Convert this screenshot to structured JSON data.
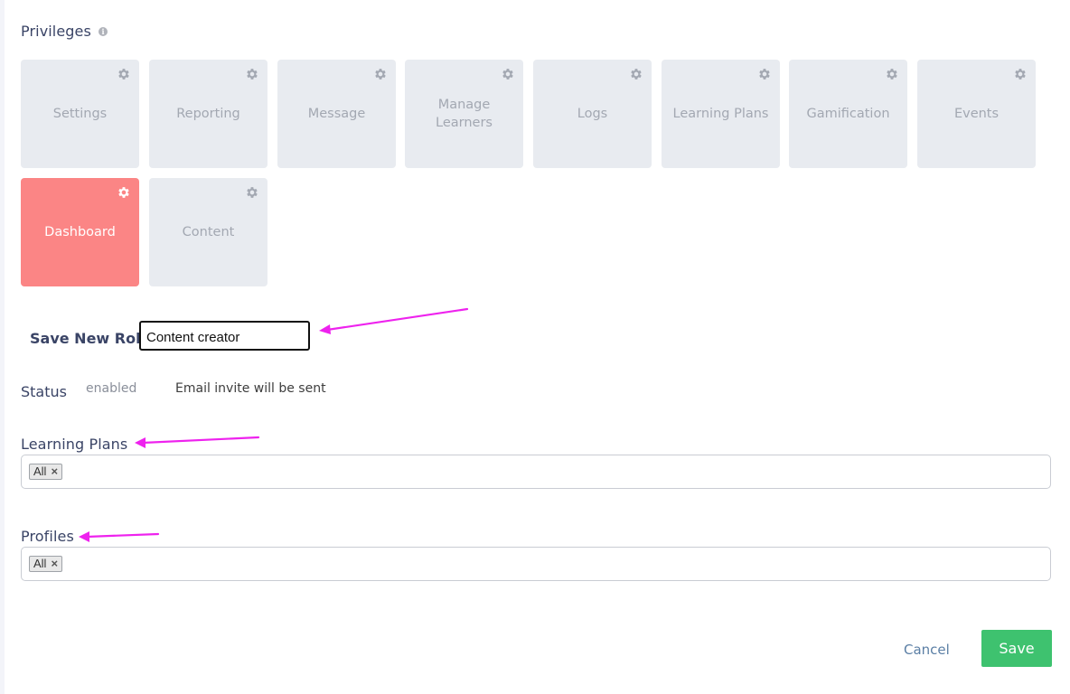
{
  "privileges": {
    "title": "Privileges",
    "info_icon": "info-icon",
    "tiles": [
      {
        "label": "Settings",
        "active": false
      },
      {
        "label": "Reporting",
        "active": false
      },
      {
        "label": "Message",
        "active": false
      },
      {
        "label": "Manage Learners",
        "active": false
      },
      {
        "label": "Logs",
        "active": false
      },
      {
        "label": "Learning Plans",
        "active": false
      },
      {
        "label": "Gamification",
        "active": false
      },
      {
        "label": "Events",
        "active": false
      },
      {
        "label": "Dashboard",
        "active": true
      },
      {
        "label": "Content",
        "active": false
      }
    ],
    "tile_icon": "gear-icon",
    "active_color": "#fb8585",
    "inactive_color": "#e8ebf0"
  },
  "role": {
    "label": "Save New Role",
    "value": "Content creator"
  },
  "status": {
    "label": "Status",
    "value": "enabled",
    "note": "Email invite will be sent"
  },
  "learning_plans": {
    "label": "Learning Plans",
    "chips": [
      {
        "label": "All",
        "remove": "×"
      }
    ]
  },
  "profiles": {
    "label": "Profiles",
    "chips": [
      {
        "label": "All",
        "remove": "×"
      }
    ]
  },
  "actions": {
    "cancel_label": "Cancel",
    "save_label": "Save",
    "save_color": "#3ec26f"
  },
  "annotation_color": "#ee22ee"
}
